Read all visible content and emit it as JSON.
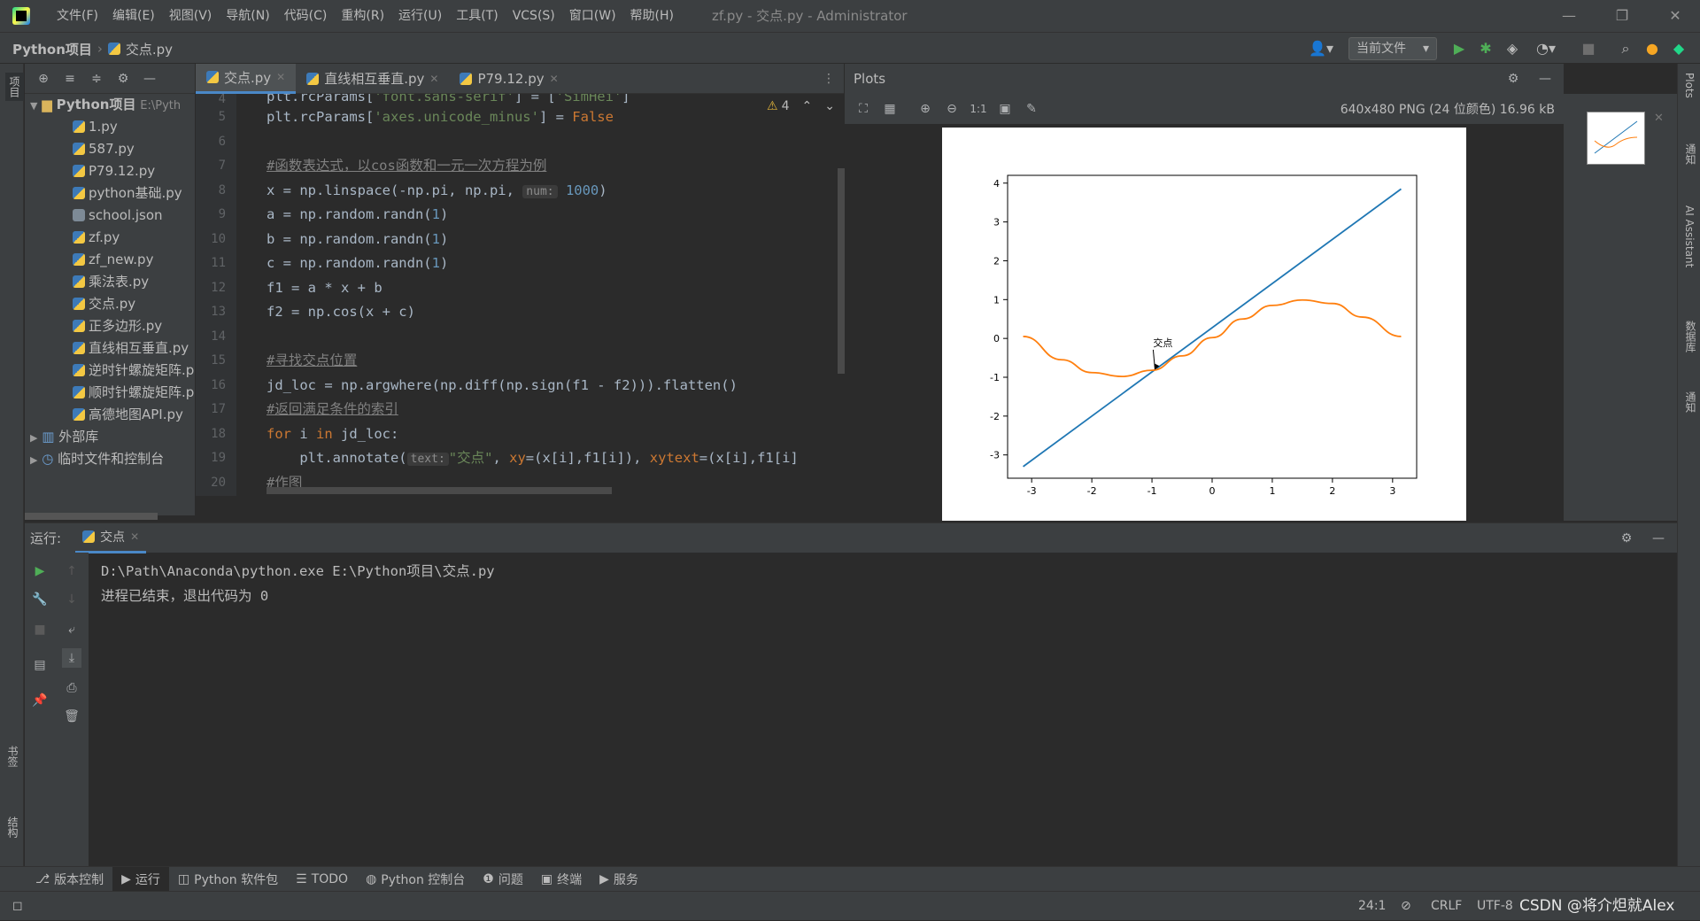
{
  "menu": [
    "文件(F)",
    "编辑(E)",
    "视图(V)",
    "导航(N)",
    "代码(C)",
    "重构(R)",
    "运行(U)",
    "工具(T)",
    "VCS(S)",
    "窗口(W)",
    "帮助(H)"
  ],
  "window_title": "zf.py - 交点.py - Administrator",
  "breadcrumb": {
    "project": "Python项目",
    "file": "交点.py"
  },
  "run_config": "当前文件",
  "left_strip": {
    "project": "项目",
    "bookmarks": "书签",
    "structure": "结构"
  },
  "right_strip": [
    "Plots",
    "通知",
    "AI Assistant",
    "数据库",
    "通知"
  ],
  "project_panel": {
    "root": "Python项目",
    "root_path": "E:\\Pyth",
    "files": [
      "1.py",
      "587.py",
      "P79.12.py",
      "python基础.py",
      "school.json",
      "zf.py",
      "zf_new.py",
      "乘法表.py",
      "交点.py",
      "正多边形.py",
      "直线相互垂直.py",
      "逆时针螺旋矩阵.p",
      "顺时针螺旋矩阵.p",
      "高德地图API.py"
    ],
    "external": "外部库",
    "scratch": "临时文件和控制台"
  },
  "editor": {
    "tabs": [
      "交点.py",
      "直线相互垂直.py",
      "P79.12.py"
    ],
    "warnings": "4",
    "line_numbers": [
      "4",
      "5",
      "6",
      "7",
      "8",
      "9",
      "10",
      "11",
      "12",
      "13",
      "14",
      "15",
      "16",
      "17",
      "18",
      "19",
      "20"
    ]
  },
  "plots": {
    "title": "Plots",
    "info": "640x480 PNG (24 位颜色) 16.96 kB"
  },
  "chart_data": {
    "type": "line",
    "xlim": [
      -3.4,
      3.4
    ],
    "ylim": [
      -3.6,
      4.2
    ],
    "xticks": [
      "-3",
      "-2",
      "-1",
      "0",
      "1",
      "2",
      "3"
    ],
    "yticks": [
      "-3",
      "-2",
      "-1",
      "0",
      "1",
      "2",
      "3",
      "4"
    ],
    "series": [
      {
        "color": "#1f77b4",
        "x": [
          -3.1416,
          3.1416
        ],
        "y": [
          -3.3,
          3.85
        ]
      },
      {
        "color": "#ff7f0e",
        "x": [
          -3.1416,
          -2.5,
          -2.0,
          -1.5,
          -1.0,
          -0.5,
          0.0,
          0.5,
          1.0,
          1.5,
          2.0,
          2.5,
          3.1416
        ],
        "y": [
          0.05,
          -0.55,
          -0.88,
          -0.98,
          -0.82,
          -0.45,
          0.02,
          0.5,
          0.85,
          0.99,
          0.9,
          0.55,
          0.05
        ]
      }
    ],
    "annotation": {
      "text": "交点",
      "x": -0.95,
      "y": -0.8,
      "xytext": [
        -0.98,
        -0.2
      ]
    }
  },
  "run": {
    "label": "运行:",
    "tab": "交点",
    "lines": [
      "D:\\Path\\Anaconda\\python.exe E:\\Python项目\\交点.py",
      "",
      "进程已结束，退出代码为 0"
    ]
  },
  "bottom_tabs": [
    "版本控制",
    "运行",
    "Python 软件包",
    "TODO",
    "Python 控制台",
    "问题",
    "终端",
    "服务"
  ],
  "status": {
    "pos": "24:1",
    "eol": "CRLF",
    "enc": "UTF-8",
    "watermark": "CSDN @将介炟就Alex"
  }
}
